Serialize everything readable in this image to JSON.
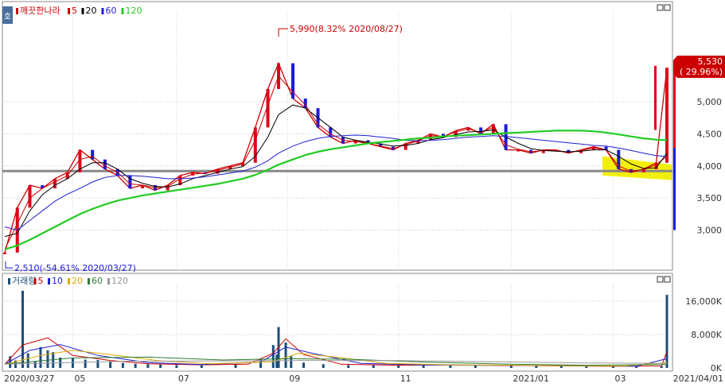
{
  "header": {
    "side_tab": "호",
    "legend": [
      {
        "label": "깨끗한나라",
        "color": "#cc0000"
      },
      {
        "label": "5",
        "color": "#cc0000"
      },
      {
        "label": "20",
        "color": "#000000"
      },
      {
        "label": "60",
        "color": "#1f1fd1"
      },
      {
        "label": "120",
        "color": "#22cc22"
      }
    ]
  },
  "volume_header": {
    "legend": [
      {
        "label": "거래량",
        "color": "#1c4e7a"
      },
      {
        "label": "5",
        "color": "#cc0000"
      },
      {
        "label": "10",
        "color": "#1f1fd1"
      },
      {
        "label": "20",
        "color": "#ddaa00"
      },
      {
        "label": "60",
        "color": "#2e7d32"
      },
      {
        "label": "120",
        "color": "#999999"
      }
    ]
  },
  "annotations": {
    "high": "5,990(8.32% 2020/08/27)",
    "low": "2,510(-54.61% 2020/03/27)",
    "current_price": "5,530",
    "current_change": "( 29.96%)"
  },
  "chart_data": [
    {
      "type": "candlestick",
      "title": "깨끗한나라",
      "y_ticks": [
        3000,
        3500,
        4000,
        4500,
        5000
      ],
      "y_tick_labels": [
        "3,000",
        "3,500",
        "4,000",
        "4,500",
        "5,000"
      ],
      "ylim": [
        2400,
        6400
      ],
      "x_tick_labels": [
        "2020/03/27",
        "05",
        "07",
        "09",
        "11",
        "2021/01",
        "03",
        "2021/04/01"
      ],
      "x_tick_dates": [
        "2020-03-27",
        "2020-05-04",
        "2020-07-01",
        "2020-09-01",
        "2020-11-02",
        "2021-01-04",
        "2021-03-02",
        "2021-04-01"
      ],
      "horizontal_line": 3920,
      "high": {
        "date": "2020-08-27",
        "value": 5990
      },
      "low": {
        "date": "2020-03-27",
        "value": 2510
      },
      "last_close": 5530,
      "series": [
        {
          "name": "종가",
          "color": "#cc0000",
          "x": [
            "2020-03-27",
            "2020-04-03",
            "2020-04-10",
            "2020-04-17",
            "2020-04-24",
            "2020-05-01",
            "2020-05-08",
            "2020-05-15",
            "2020-05-22",
            "2020-05-29",
            "2020-06-05",
            "2020-06-12",
            "2020-06-19",
            "2020-06-26",
            "2020-07-03",
            "2020-07-10",
            "2020-07-17",
            "2020-07-24",
            "2020-07-31",
            "2020-08-07",
            "2020-08-14",
            "2020-08-21",
            "2020-08-27",
            "2020-09-04",
            "2020-09-11",
            "2020-09-18",
            "2020-09-25",
            "2020-10-02",
            "2020-10-09",
            "2020-10-16",
            "2020-10-23",
            "2020-10-30",
            "2020-11-06",
            "2020-11-13",
            "2020-11-20",
            "2020-11-27",
            "2020-12-04",
            "2020-12-11",
            "2020-12-18",
            "2020-12-25",
            "2021-01-01",
            "2021-01-08",
            "2021-01-15",
            "2021-01-22",
            "2021-01-29",
            "2021-02-05",
            "2021-02-12",
            "2021-02-19",
            "2021-02-26",
            "2021-03-05",
            "2021-03-12",
            "2021-03-19",
            "2021-03-26",
            "2021-04-01"
          ],
          "values": [
            2650,
            3350,
            3700,
            3650,
            3800,
            3900,
            4250,
            4100,
            3950,
            3850,
            3650,
            3700,
            3620,
            3700,
            3850,
            3900,
            3880,
            3950,
            4000,
            4050,
            4600,
            5200,
            5600,
            5050,
            4900,
            4600,
            4450,
            4350,
            4400,
            4350,
            4300,
            4250,
            4350,
            4400,
            4500,
            4450,
            4550,
            4600,
            4500,
            4650,
            4250,
            4250,
            4200,
            4250,
            4250,
            4200,
            4250,
            4300,
            4250,
            3950,
            3900,
            3950,
            4050,
            5530
          ]
        },
        {
          "name": "5",
          "color": "#cc0000",
          "values": [
            2700,
            3100,
            3500,
            3650,
            3750,
            3850,
            4100,
            4150,
            4000,
            3900,
            3720,
            3700,
            3660,
            3680,
            3800,
            3870,
            3890,
            3930,
            3980,
            4030,
            4400,
            4950,
            5400,
            5150,
            4950,
            4650,
            4500,
            4400,
            4380,
            4350,
            4310,
            4270,
            4330,
            4390,
            4470,
            4460,
            4530,
            4580,
            4520,
            4600,
            4330,
            4260,
            4220,
            4240,
            4240,
            4210,
            4240,
            4280,
            4250,
            4000,
            3920,
            3940,
            4020,
            4150
          ]
        },
        {
          "name": "20",
          "color": "#000000",
          "values": [
            2900,
            2950,
            3300,
            3550,
            3700,
            3800,
            3950,
            4050,
            4050,
            3950,
            3800,
            3730,
            3680,
            3670,
            3720,
            3800,
            3850,
            3900,
            3950,
            3990,
            4150,
            4450,
            4800,
            4950,
            4900,
            4750,
            4600,
            4450,
            4400,
            4370,
            4340,
            4310,
            4320,
            4350,
            4410,
            4440,
            4490,
            4530,
            4540,
            4560,
            4450,
            4350,
            4270,
            4240,
            4230,
            4220,
            4230,
            4250,
            4250,
            4150,
            4030,
            3960,
            3970,
            4200
          ]
        },
        {
          "name": "60",
          "color": "#1f1fd1",
          "values": [
            3050,
            3000,
            3150,
            3300,
            3450,
            3560,
            3650,
            3750,
            3820,
            3850,
            3850,
            3840,
            3820,
            3800,
            3800,
            3810,
            3830,
            3860,
            3890,
            3920,
            3980,
            4080,
            4200,
            4310,
            4380,
            4430,
            4460,
            4470,
            4480,
            4470,
            4450,
            4430,
            4400,
            4390,
            4400,
            4410,
            4430,
            4450,
            4460,
            4470,
            4460,
            4440,
            4420,
            4400,
            4380,
            4360,
            4340,
            4320,
            4310,
            4280,
            4240,
            4200,
            4160,
            4150
          ]
        },
        {
          "name": "120",
          "color": "#22cc22",
          "values": [
            2700,
            2760,
            2850,
            2950,
            3050,
            3150,
            3250,
            3330,
            3400,
            3460,
            3500,
            3540,
            3570,
            3600,
            3630,
            3660,
            3690,
            3720,
            3760,
            3800,
            3860,
            3940,
            4020,
            4100,
            4170,
            4220,
            4260,
            4290,
            4320,
            4350,
            4370,
            4390,
            4410,
            4430,
            4440,
            4460,
            4470,
            4480,
            4490,
            4500,
            4510,
            4520,
            4530,
            4540,
            4550,
            4550,
            4550,
            4540,
            4520,
            4490,
            4460,
            4430,
            4410,
            4400
          ]
        }
      ]
    },
    {
      "type": "bar",
      "title": "거래량",
      "y_ticks": [
        0,
        8000,
        16000
      ],
      "y_tick_labels": [
        "0K",
        "8,000K",
        "16,000K"
      ],
      "ylim": [
        0,
        20000
      ],
      "series": [
        {
          "name": "거래량",
          "color": "#1c4e7a",
          "x": [
            "2020-03-30",
            "2020-04-02",
            "2020-04-06",
            "2020-04-09",
            "2020-04-13",
            "2020-04-16",
            "2020-04-20",
            "2020-04-23",
            "2020-04-27",
            "2020-05-04",
            "2020-05-11",
            "2020-05-18",
            "2020-05-25",
            "2020-06-01",
            "2020-06-08",
            "2020-06-15",
            "2020-06-22",
            "2020-07-01",
            "2020-07-15",
            "2020-08-03",
            "2020-08-17",
            "2020-08-24",
            "2020-08-26",
            "2020-08-27",
            "2020-08-31",
            "2020-09-03",
            "2020-09-10",
            "2020-09-21",
            "2020-10-05",
            "2020-10-19",
            "2020-11-02",
            "2020-11-16",
            "2020-12-01",
            "2020-12-15",
            "2021-01-04",
            "2021-01-18",
            "2021-02-01",
            "2021-02-15",
            "2021-03-02",
            "2021-03-15",
            "2021-03-29",
            "2021-04-01"
          ],
          "values": [
            2800,
            1800,
            18500,
            3500,
            1500,
            5000,
            4200,
            3800,
            2500,
            2400,
            2000,
            1900,
            1500,
            1200,
            1000,
            900,
            800,
            700,
            650,
            800,
            2200,
            5500,
            3200,
            9800,
            6100,
            2800,
            1300,
            900,
            700,
            650,
            600,
            600,
            650,
            700,
            600,
            550,
            500,
            450,
            400,
            350,
            400,
            17500
          ]
        },
        {
          "name": "5",
          "color": "#cc0000",
          "x": [
            "2020-03-27",
            "2020-04-06",
            "2020-04-20",
            "2020-05-04",
            "2020-05-25",
            "2020-06-15",
            "2020-07-15",
            "2020-08-10",
            "2020-08-24",
            "2020-08-31",
            "2020-09-10",
            "2020-10-01",
            "2020-11-01",
            "2020-12-01",
            "2021-01-04",
            "2021-02-01",
            "2021-03-02",
            "2021-03-29",
            "2021-04-01"
          ],
          "values": [
            900,
            5500,
            7200,
            3000,
            1800,
            1000,
            750,
            900,
            3500,
            7000,
            3200,
            900,
            650,
            700,
            600,
            500,
            400,
            450,
            4000
          ]
        },
        {
          "name": "10",
          "color": "#1f1fd1",
          "x": [
            "2020-03-27",
            "2020-04-10",
            "2020-04-27",
            "2020-05-18",
            "2020-06-15",
            "2020-07-15",
            "2020-08-17",
            "2020-08-31",
            "2020-09-14",
            "2020-10-12",
            "2020-11-16",
            "2020-12-15",
            "2021-01-18",
            "2021-02-15",
            "2021-03-15",
            "2021-04-01"
          ],
          "values": [
            900,
            4200,
            5600,
            3000,
            1300,
            800,
            1400,
            5000,
            3600,
            1100,
            700,
            650,
            580,
            480,
            400,
            2200
          ]
        },
        {
          "name": "20",
          "color": "#ddaa00",
          "x": [
            "2020-03-27",
            "2020-04-16",
            "2020-05-04",
            "2020-05-25",
            "2020-06-22",
            "2020-07-20",
            "2020-08-24",
            "2020-09-07",
            "2020-09-28",
            "2020-10-26",
            "2020-11-30",
            "2021-01-04",
            "2021-02-08",
            "2021-03-08",
            "2021-04-01"
          ],
          "values": [
            900,
            3000,
            4200,
            3200,
            1700,
            1000,
            1500,
            3500,
            2600,
            1100,
            750,
            650,
            520,
            450,
            1300
          ]
        },
        {
          "name": "60",
          "color": "#2e7d32",
          "x": [
            "2020-03-27",
            "2020-05-04",
            "2020-06-15",
            "2020-07-27",
            "2020-08-31",
            "2020-10-05",
            "2020-11-16",
            "2021-01-04",
            "2021-02-15",
            "2021-04-01"
          ],
          "values": [
            900,
            2400,
            2600,
            1900,
            2200,
            2100,
            1400,
            900,
            650,
            800
          ]
        },
        {
          "name": "120",
          "color": "#999999",
          "x": [
            "2020-03-27",
            "2020-06-01",
            "2020-08-03",
            "2020-09-14",
            "2020-11-02",
            "2020-12-21",
            "2021-02-15",
            "2021-04-01"
          ],
          "values": [
            900,
            1600,
            1700,
            1800,
            1750,
            1500,
            1200,
            1100
          ]
        }
      ]
    }
  ]
}
